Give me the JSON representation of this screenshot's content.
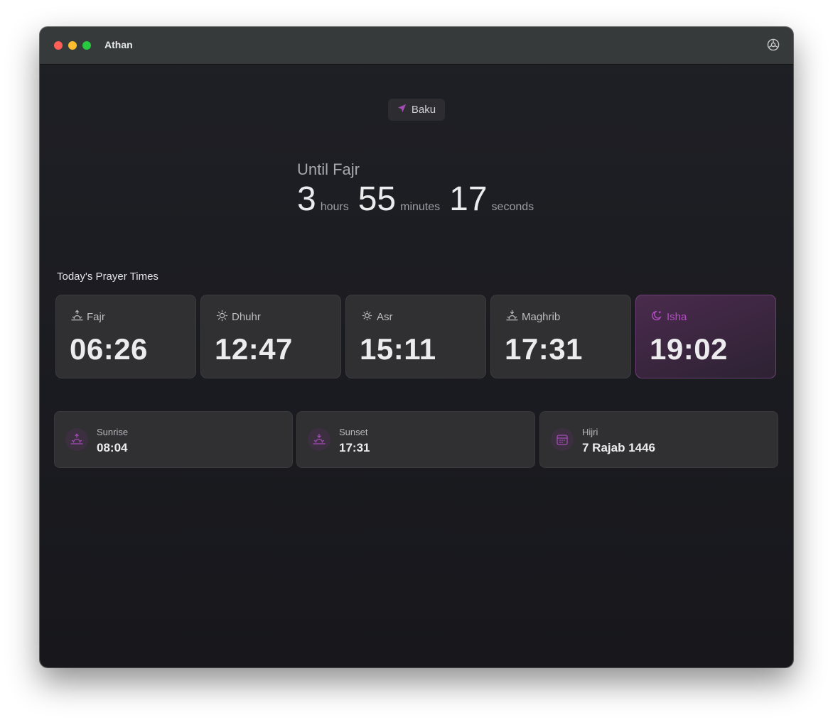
{
  "app": {
    "title": "Athan"
  },
  "location": {
    "city": "Baku",
    "accent": "#a34cb4"
  },
  "countdown": {
    "label": "Until Fajr",
    "hours": "3",
    "hours_unit": "hours",
    "minutes": "55",
    "minutes_unit": "minutes",
    "seconds": "17",
    "seconds_unit": "seconds"
  },
  "prayers": {
    "title": "Today's Prayer Times",
    "items": [
      {
        "name": "Fajr",
        "time": "06:26",
        "icon": "sunrise-icon"
      },
      {
        "name": "Dhuhr",
        "time": "12:47",
        "icon": "sun-icon"
      },
      {
        "name": "Asr",
        "time": "15:11",
        "icon": "sun-icon"
      },
      {
        "name": "Maghrib",
        "time": "17:31",
        "icon": "sunset-icon"
      },
      {
        "name": "Isha",
        "time": "19:02",
        "icon": "moon-icon",
        "active": true
      }
    ]
  },
  "info": {
    "sunrise": {
      "label": "Sunrise",
      "value": "08:04",
      "icon": "sunrise-icon"
    },
    "sunset": {
      "label": "Sunset",
      "value": "17:31",
      "icon": "sunset-icon"
    },
    "hijri": {
      "label": "Hijri",
      "value": "7 Rajab 1446",
      "icon": "calendar-icon"
    }
  },
  "colors": {
    "accent": "#a34cb4",
    "background": "#1c1c21",
    "card": "#303033",
    "titlebar": "#373a3b"
  }
}
